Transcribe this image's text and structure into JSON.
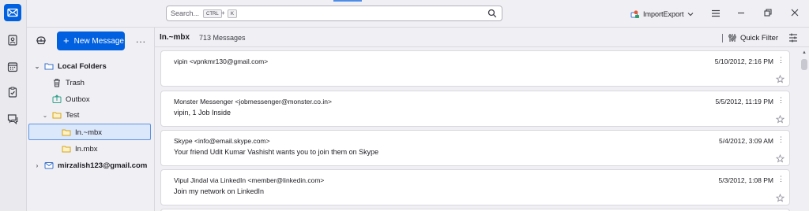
{
  "search": {
    "placeholder": "Search...",
    "key1": "CTRL",
    "plus": "+",
    "key2": "K"
  },
  "account": {
    "label": "ImportExport"
  },
  "toolbar": {
    "new_message": "New Message",
    "more": "..."
  },
  "folders": [
    {
      "label": "Local Folders",
      "bold": true
    },
    {
      "label": "Trash"
    },
    {
      "label": "Outbox"
    },
    {
      "label": "Test"
    },
    {
      "label": "In.~mbx",
      "selected": true
    },
    {
      "label": "In.mbx"
    },
    {
      "label": "mirzalish123@gmail.com",
      "bold": true
    }
  ],
  "thread_header": {
    "folder": "In.~mbx",
    "count": "713 Messages",
    "quick_filter": "Quick Filter"
  },
  "messages": [
    {
      "from": "vipin <vpnkmr130@gmail.com>",
      "subject": "",
      "date": "5/10/2012, 2:16 PM"
    },
    {
      "from": "Monster Messenger <jobmessenger@monster.co.in>",
      "subject": "vipin, 1 Job Inside",
      "date": "5/5/2012, 11:19 PM"
    },
    {
      "from": "Skype <info@email.skype.com>",
      "subject": "Your friend Udit Kumar Vashisht wants you to join them on Skype",
      "date": "5/4/2012, 3:09 AM"
    },
    {
      "from": "Vipul Jindal via LinkedIn <member@linkedin.com>",
      "subject": "Join my network on LinkedIn",
      "date": "5/3/2012, 1:08 PM"
    }
  ],
  "colors": {
    "accent": "#0060df",
    "selection": "#dbe7fb"
  }
}
